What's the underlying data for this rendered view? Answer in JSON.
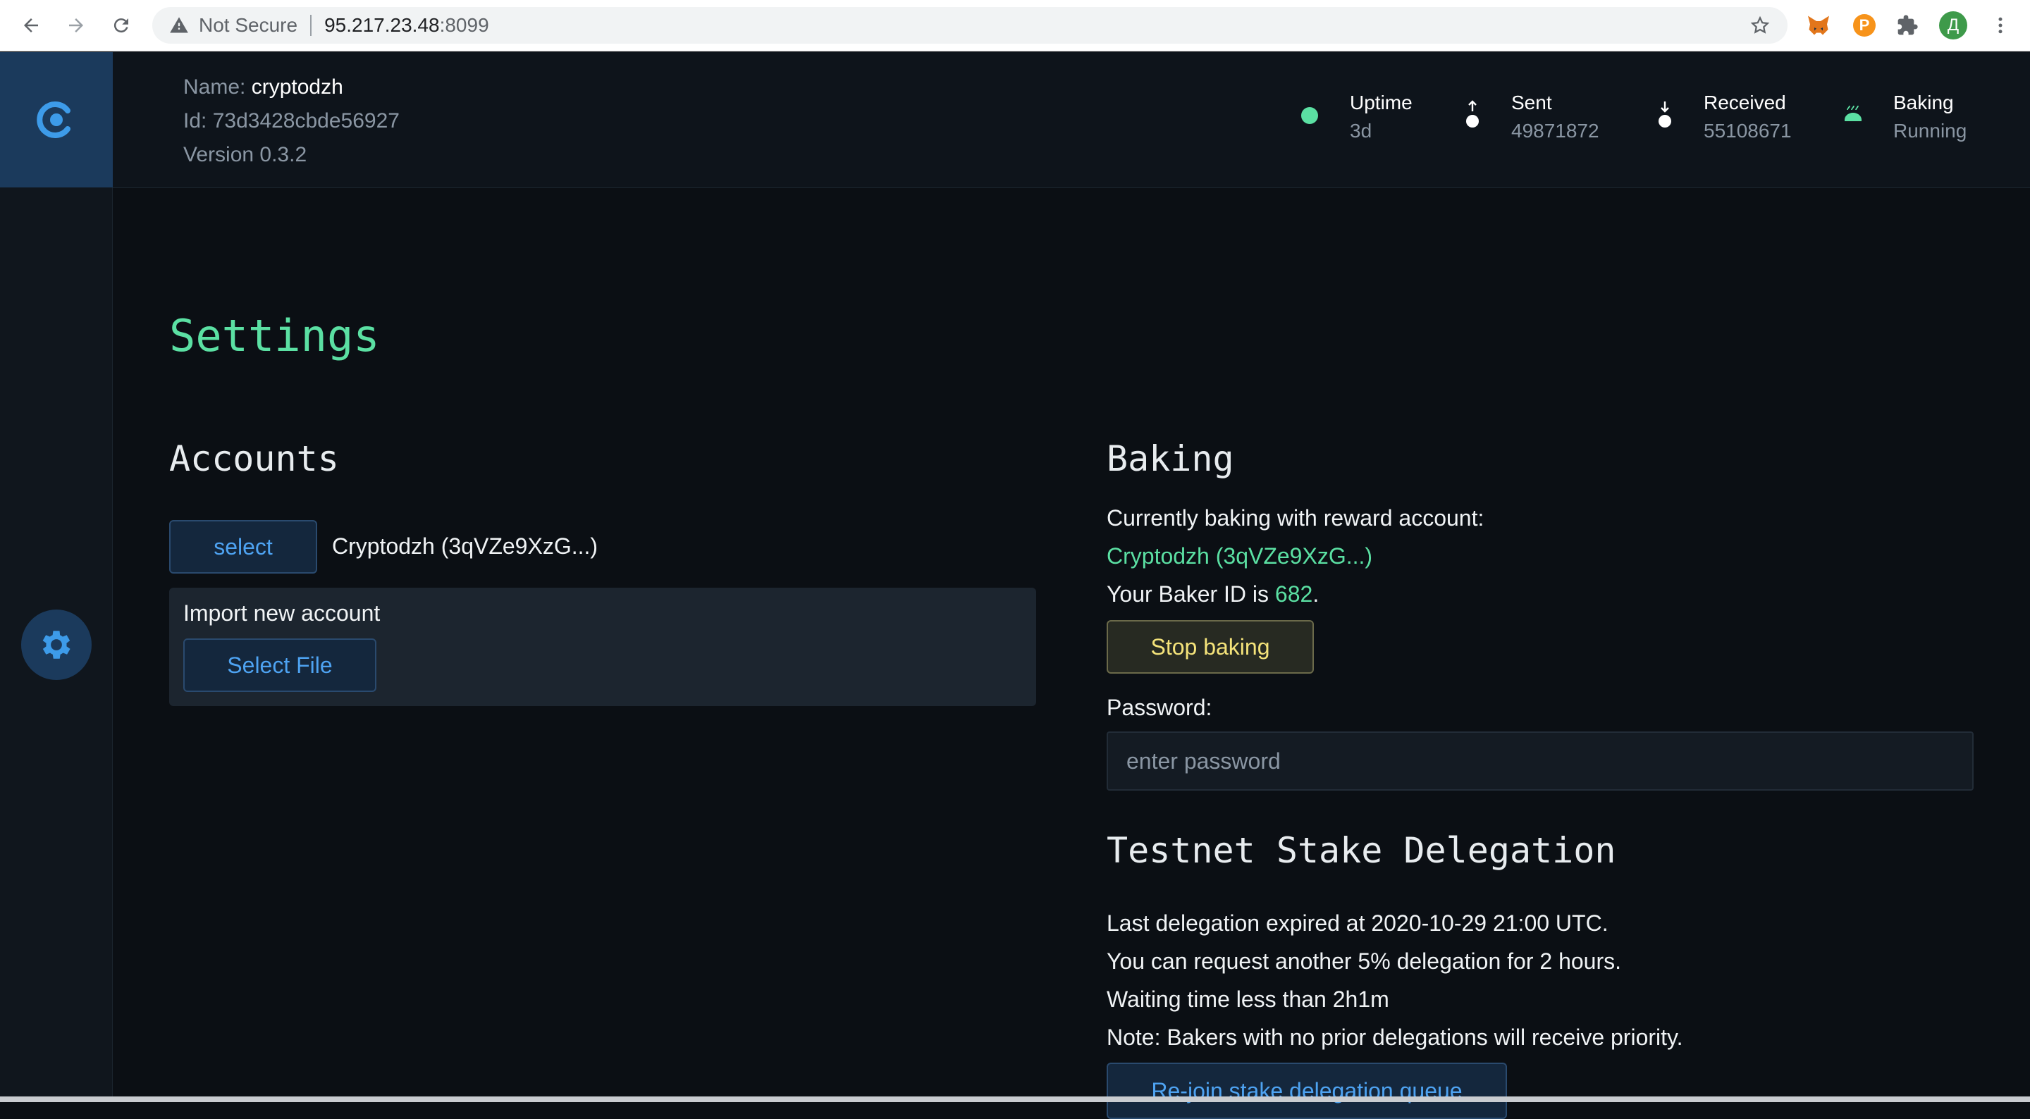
{
  "browser": {
    "security_label": "Not Secure",
    "url_host": "95.217.23.48",
    "url_port": ":8099",
    "profile_initial": "Д",
    "coin_ext_label": "P"
  },
  "node": {
    "name_label": "Name:",
    "name": "cryptodzh",
    "id_label": "Id:",
    "id": "73d3428cbde56927",
    "version": "Version 0.3.2"
  },
  "stats": {
    "uptime_label": "Uptime",
    "uptime_value": "3d",
    "sent_label": "Sent",
    "sent_value": "49871872",
    "received_label": "Received",
    "received_value": "55108671",
    "baking_label": "Baking",
    "baking_value": "Running"
  },
  "page": {
    "title": "Settings"
  },
  "accounts": {
    "heading": "Accounts",
    "select_label": "select",
    "selected_account": "Cryptodzh (3qVZe9XzG...)",
    "import_title": "Import new account",
    "select_file_label": "Select File"
  },
  "baking": {
    "heading": "Baking",
    "currently_text": "Currently baking with reward account:",
    "reward_account": "Cryptodzh (3qVZe9XzG...)",
    "baker_id_prefix": "Your Baker ID is ",
    "baker_id": "682",
    "baker_id_suffix": ".",
    "stop_label": "Stop baking",
    "password_label": "Password:",
    "password_placeholder": "enter password"
  },
  "delegation": {
    "heading": "Testnet Stake Delegation",
    "line1": "Last delegation expired at 2020-10-29 21:00 UTC.",
    "line2": "You can request another 5% delegation for 2 hours.",
    "line3": "Waiting time less than 2h1m",
    "line4": "Note: Bakers with no prior delegations will receive priority.",
    "rejoin_label": "Re-join stake delegation queue"
  },
  "colors": {
    "accent_green": "#5be0a3",
    "accent_blue": "#4ea3f2",
    "warning_yellow": "#f4e37a",
    "background": "#0b0f14"
  }
}
